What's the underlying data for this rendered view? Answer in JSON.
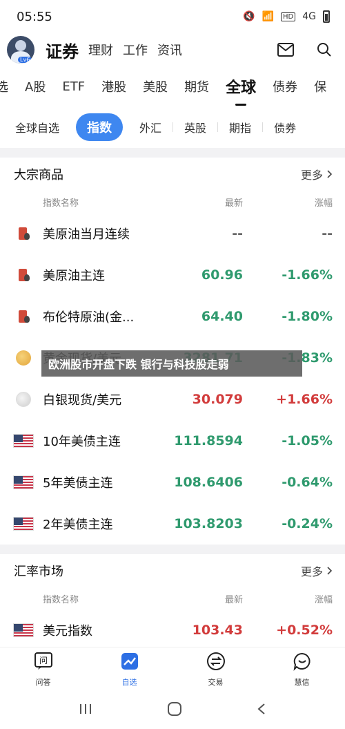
{
  "status": {
    "time": "05:55",
    "hd": "HD",
    "signal": "4G"
  },
  "header": {
    "avatar_level": "Lv6",
    "tabs": [
      {
        "label": "证券",
        "active": true
      },
      {
        "label": "理财"
      },
      {
        "label": "工作"
      },
      {
        "label": "资讯"
      }
    ]
  },
  "market_tabs": [
    "选",
    "A股",
    "ETF",
    "港股",
    "美股",
    "期货",
    "全球",
    "债券",
    "保"
  ],
  "market_active": "全球",
  "sub_tabs": [
    "全球自选",
    "指数",
    "外汇",
    "英股",
    "期指",
    "债券"
  ],
  "sub_active": "指数",
  "commodities": {
    "title": "大宗商品",
    "more": "更多",
    "columns": [
      "指数名称",
      "最新",
      "涨幅"
    ],
    "rows": [
      {
        "icon": "oil-icon",
        "name": "美原油当月连续",
        "price": "--",
        "change": "--",
        "trend": "flat"
      },
      {
        "icon": "oil-icon",
        "name": "美原油主连",
        "price": "60.96",
        "change": "-1.66%",
        "trend": "down"
      },
      {
        "icon": "oil-icon",
        "name": "布伦特原油(金...",
        "price": "64.40",
        "change": "-1.80%",
        "trend": "down"
      },
      {
        "icon": "gold-icon",
        "name": "黄金现货/美元",
        "price": "3281.71",
        "change": "-1.83%",
        "trend": "down"
      },
      {
        "icon": "silver-icon",
        "name": "白银现货/美元",
        "price": "30.079",
        "change": "+1.66%",
        "trend": "up"
      },
      {
        "icon": "us-flag-icon",
        "name": "10年美债主连",
        "price": "111.8594",
        "change": "-1.05%",
        "trend": "down"
      },
      {
        "icon": "us-flag-icon",
        "name": "5年美债主连",
        "price": "108.6406",
        "change": "-0.64%",
        "trend": "down"
      },
      {
        "icon": "us-flag-icon",
        "name": "2年美债主连",
        "price": "103.8203",
        "change": "-0.24%",
        "trend": "down"
      }
    ]
  },
  "forex": {
    "title": "汇率市场",
    "more": "更多",
    "columns": [
      "指数名称",
      "最新",
      "涨幅"
    ],
    "rows": [
      {
        "icon": "us-flag-icon",
        "name": "美元指数",
        "price": "103.43",
        "change": "+0.52%",
        "trend": "up"
      }
    ]
  },
  "toast": "欧洲股市开盘下跌 银行与科技股走弱",
  "bottom_nav": [
    {
      "label": "问答",
      "icon": "qa-icon"
    },
    {
      "label": "自选",
      "icon": "watchlist-icon",
      "active": true
    },
    {
      "label": "交易",
      "icon": "trade-icon"
    },
    {
      "label": "慧信",
      "icon": "chat-icon"
    }
  ],
  "colors": {
    "up": "#d23c3c",
    "down": "#2f9a6e",
    "accent": "#3e87f0"
  }
}
